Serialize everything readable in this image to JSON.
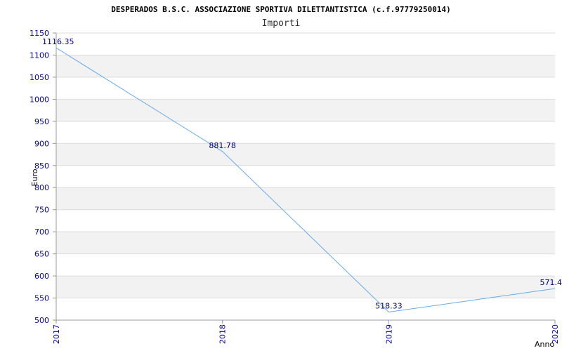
{
  "chart_data": {
    "type": "line",
    "title": "DESPERADOS B.S.C. ASSOCIAZIONE SPORTIVA DILETTANTISTICA (c.f.97779250014)",
    "subtitle": "Importi",
    "xlabel": "Anno",
    "ylabel": "Euro",
    "categories": [
      "2017",
      "2018",
      "2019",
      "2020"
    ],
    "series": [
      {
        "values": [
          1116.35,
          881.78,
          518.33,
          571.4
        ],
        "labels": [
          "1116.35",
          "881.78",
          "518.33",
          "571.4"
        ]
      }
    ],
    "ylim": [
      500,
      1150
    ],
    "yticks": [
      500,
      550,
      600,
      650,
      700,
      750,
      800,
      850,
      900,
      950,
      1000,
      1050,
      1100,
      1150
    ],
    "grid": true,
    "band_color": "#f2f2f2",
    "grid_color": "#dddddd",
    "line_color": "#66aaee",
    "tick_color": "#0000aa",
    "label_color": "#000080"
  }
}
